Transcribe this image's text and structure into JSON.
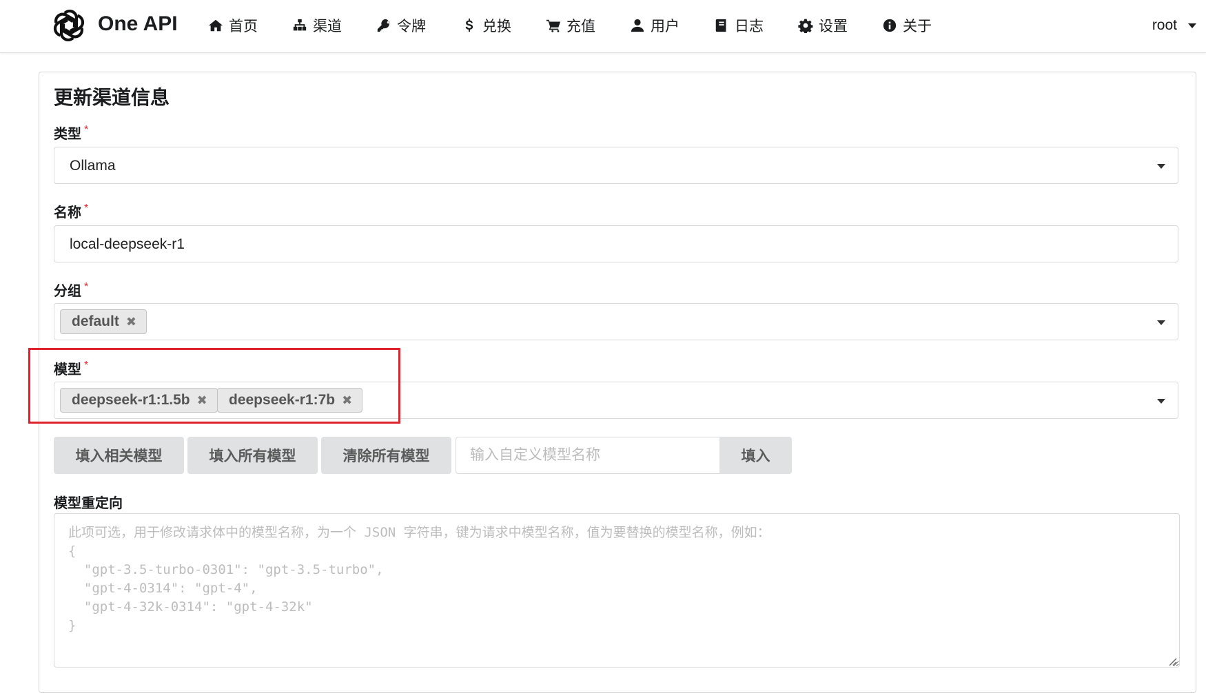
{
  "header": {
    "brand": "One API",
    "nav": [
      {
        "label": "首页",
        "icon": "home-icon"
      },
      {
        "label": "渠道",
        "icon": "sitemap-icon"
      },
      {
        "label": "令牌",
        "icon": "key-icon"
      },
      {
        "label": "兑换",
        "icon": "dollar-icon"
      },
      {
        "label": "充值",
        "icon": "cart-icon"
      },
      {
        "label": "用户",
        "icon": "user-icon"
      },
      {
        "label": "日志",
        "icon": "book-icon"
      },
      {
        "label": "设置",
        "icon": "gear-icon"
      },
      {
        "label": "关于",
        "icon": "info-icon"
      }
    ],
    "user": "root"
  },
  "form": {
    "title": "更新渠道信息",
    "required_mark": "*",
    "type": {
      "label": "类型",
      "value": "Ollama"
    },
    "name": {
      "label": "名称",
      "value": "local-deepseek-r1"
    },
    "group": {
      "label": "分组",
      "chips": [
        "default"
      ]
    },
    "models": {
      "label": "模型",
      "chips": [
        "deepseek-r1:1.5b",
        "deepseek-r1:7b"
      ]
    },
    "buttons": {
      "fill_related": "填入相关模型",
      "fill_all": "填入所有模型",
      "clear_all": "清除所有模型",
      "custom_placeholder": "输入自定义模型名称",
      "fill": "填入"
    },
    "mapping": {
      "label": "模型重定向",
      "placeholder": "此项可选，用于修改请求体中的模型名称，为一个 JSON 字符串，键为请求中模型名称，值为要替换的模型名称，例如：\n{\n  \"gpt-3.5-turbo-0301\": \"gpt-3.5-turbo\",\n  \"gpt-4-0314\": \"gpt-4\",\n  \"gpt-4-32k-0314\": \"gpt-4-32k\"\n}"
    }
  },
  "chip_remove_glyph": "✖",
  "colors": {
    "highlight": "#e0222d",
    "required": "#db2828",
    "button_bg": "#e0e1e2"
  }
}
